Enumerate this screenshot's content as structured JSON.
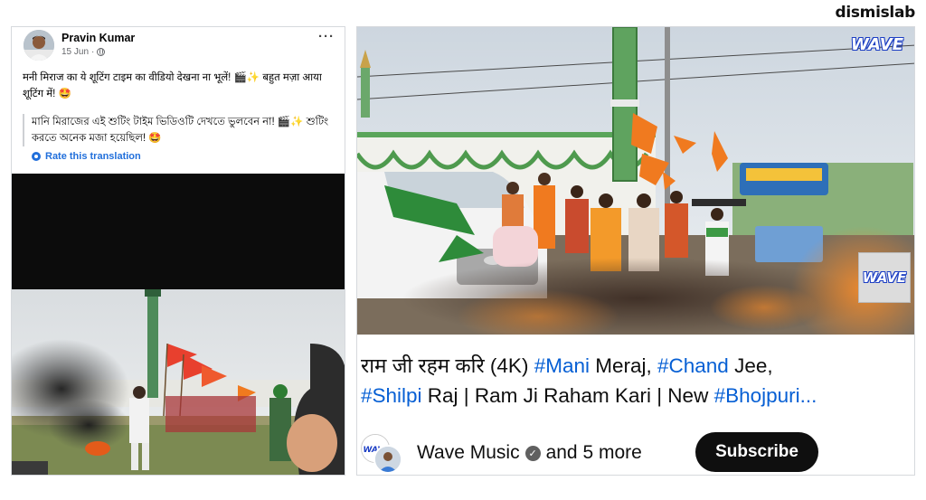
{
  "brand": {
    "text": "dismislab"
  },
  "facebook_post": {
    "author": "Pravin Kumar",
    "date": "15 Jun",
    "separator": "·",
    "more": "···",
    "post_text": "मनी मिराज का ये शूटिंग टाइम का वीडियो देखना ना भूलें! 🎬✨ बहुत मज़ा आया शूटिंग में! 🤩",
    "translation_text": "মানি মিরাজের এই শুটিং টাইম ভিডিওটি দেখতে ভুলবেন না! 🎬✨ শুটিং করতে অনেক মজা হয়েছিল! 🤩",
    "rate_translation": "Rate this translation"
  },
  "youtube": {
    "watermark_top": "WAVE",
    "watermark_box": "WAVE",
    "title_parts": [
      {
        "text": "राम जी रहम करि (4K) ",
        "tag": false
      },
      {
        "text": "#Mani",
        "tag": true
      },
      {
        "text": " Meraj, ",
        "tag": false
      },
      {
        "text": "#Chand",
        "tag": true
      },
      {
        "text": " Jee,",
        "tag": false
      },
      {
        "text": "#Shilpi",
        "tag": true
      },
      {
        "text": " Raj | Ram Ji Raham Kari | New ",
        "tag": false
      },
      {
        "text": "#Bhojpuri...",
        "tag": true
      }
    ],
    "channel_name": "Wave Music",
    "collaborators": "and 5 more",
    "subscribe_label": "Subscribe",
    "verified_glyph": "✓",
    "avatar_text": "WAVE"
  },
  "colors": {
    "fb_link": "#216fdb",
    "yt_hashtag": "#065fd4",
    "subscribe_bg": "#0f0f0f",
    "flag_orange": "#f07a1f"
  }
}
